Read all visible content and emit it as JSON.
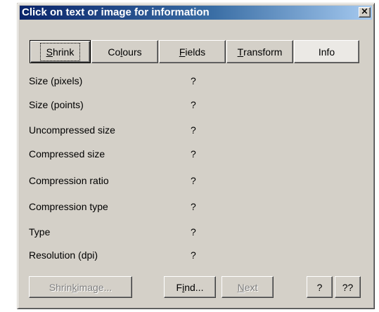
{
  "window": {
    "title": "Click on text or image for information",
    "close_glyph": "×"
  },
  "tabs": [
    {
      "label_pre": "",
      "label_key": "S",
      "label_post": "hrink"
    },
    {
      "label_pre": "Co",
      "label_key": "l",
      "label_post": "ours"
    },
    {
      "label_pre": "",
      "label_key": "F",
      "label_post": "ields"
    },
    {
      "label_pre": "",
      "label_key": "T",
      "label_post": "ransform"
    },
    {
      "label": "Info"
    }
  ],
  "properties": [
    {
      "label": "Size (pixels)",
      "value": "?"
    },
    {
      "label": "Size (points)",
      "value": "?"
    },
    {
      "label": "Uncompressed size",
      "value": "?"
    },
    {
      "label": "Compressed size",
      "value": "?"
    },
    {
      "label": "Compression ratio",
      "value": "?"
    },
    {
      "label": "Compression type",
      "value": "?"
    },
    {
      "label": "Type",
      "value": "?"
    },
    {
      "label": "Resolution (dpi)",
      "value": "?"
    }
  ],
  "buttons": {
    "shrink_image": {
      "pre": "Shrin",
      "key": "k",
      "post": " image..."
    },
    "find": {
      "pre": "F",
      "key": "i",
      "post": "nd..."
    },
    "next": {
      "pre": "",
      "key": "N",
      "post": "ext"
    },
    "help": "?",
    "help_more": "??"
  }
}
